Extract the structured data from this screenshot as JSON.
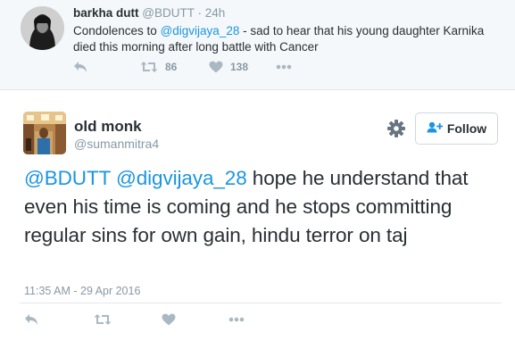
{
  "parent_tweet": {
    "name": "barkha dutt",
    "handle": "@BDUTT",
    "separator": "·",
    "time": "24h",
    "text_prefix": "Condolences to ",
    "mention": "@digvijaya_28",
    "text_suffix": " - sad to hear that his young daughter Karnika died this morning after long battle with Cancer",
    "retweet_count": "86",
    "like_count": "138"
  },
  "main_tweet": {
    "name": "old monk",
    "handle": "@sumanmitra4",
    "follow_label": "Follow",
    "mention_1": "@BDUTT",
    "mention_2": "@digvijaya_28",
    "text_body": " hope he understand that even his time is coming and he stops committing regular sins for own gain, hindu terror on taj",
    "timestamp": "11:35 AM - 29 Apr 2016"
  },
  "icons": {
    "reply": "reply-icon",
    "retweet": "retweet-icon",
    "like": "heart-icon",
    "more": "more-dots-icon",
    "settings": "gear-icon",
    "follow": "add-user-icon"
  },
  "colors": {
    "link": "#1b95e0",
    "muted": "#8899a6",
    "text": "#292f33",
    "parent_background": "#f5f8fa"
  }
}
